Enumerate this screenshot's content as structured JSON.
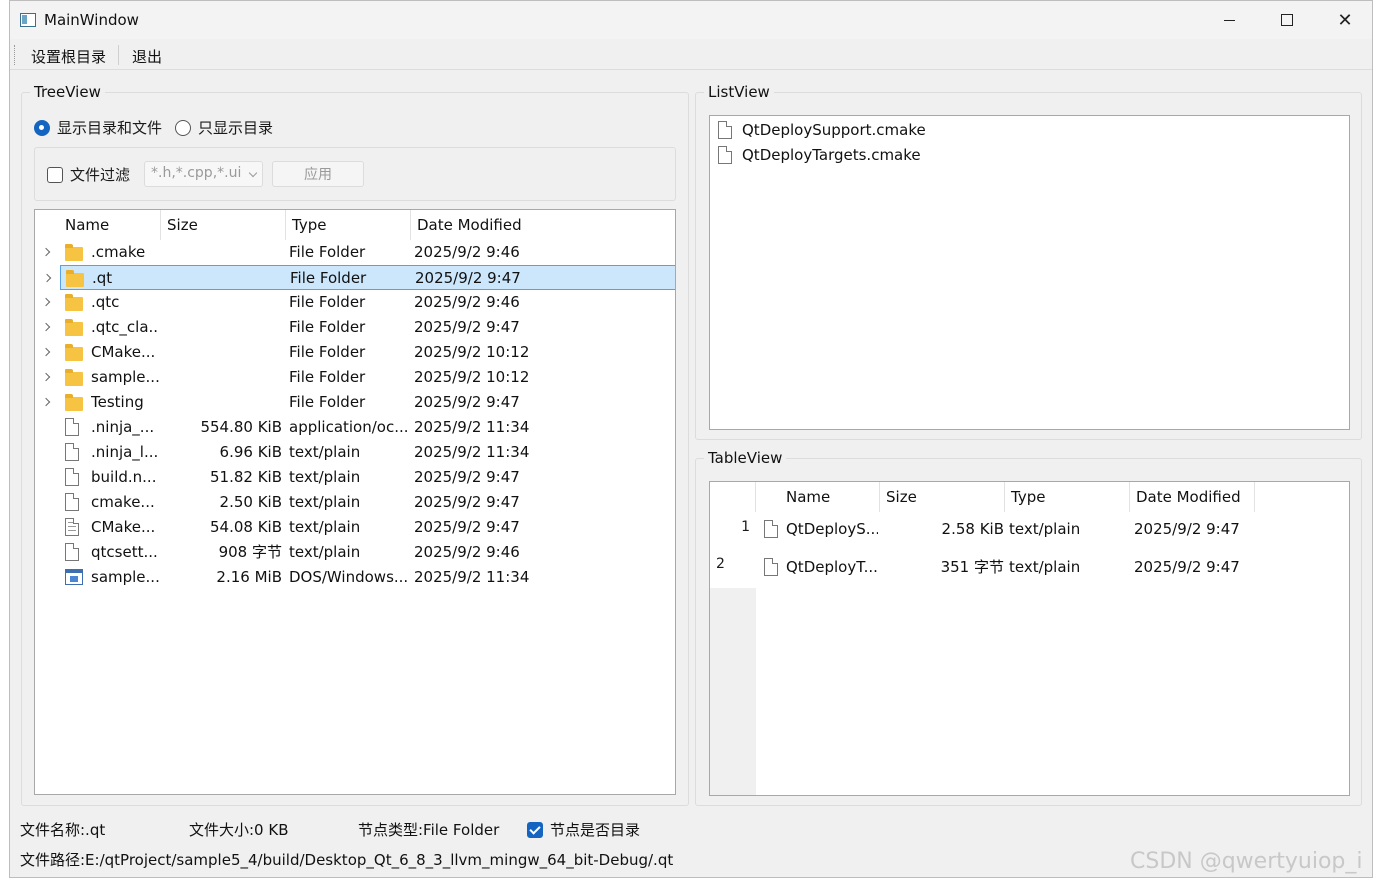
{
  "window": {
    "title": "MainWindow"
  },
  "menubar": {
    "items": [
      "设置根目录",
      "退出"
    ]
  },
  "treeview": {
    "group_title": "TreeView",
    "radio_all": "显示目录和文件",
    "radio_dirs": "只显示目录",
    "filter_label": "文件过滤",
    "filter_value": "*.h,*.cpp,*.ui",
    "apply_label": "应用",
    "headers": [
      "Name",
      "Size",
      "Type",
      "Date Modified"
    ],
    "rows": [
      {
        "name": ".cmake",
        "size": "",
        "type": "File Folder",
        "date": "2025/9/2 9:46",
        "icon": "folder-icon"
      },
      {
        "name": ".qt",
        "size": "",
        "type": "File Folder",
        "date": "2025/9/2 9:47",
        "icon": "folder-icon"
      },
      {
        "name": ".qtc",
        "size": "",
        "type": "File Folder",
        "date": "2025/9/2 9:46",
        "icon": "folder-icon"
      },
      {
        "name": ".qtc_cla...",
        "size": "",
        "type": "File Folder",
        "date": "2025/9/2 9:47",
        "icon": "folder-icon"
      },
      {
        "name": "CMake...",
        "size": "",
        "type": "File Folder",
        "date": "2025/9/2 10:12",
        "icon": "folder-icon"
      },
      {
        "name": "sample...",
        "size": "",
        "type": "File Folder",
        "date": "2025/9/2 10:12",
        "icon": "folder-icon"
      },
      {
        "name": "Testing",
        "size": "",
        "type": "File Folder",
        "date": "2025/9/2 9:47",
        "icon": "folder-icon"
      },
      {
        "name": ".ninja_...",
        "size": "554.80 KiB",
        "type": "application/oc...",
        "date": "2025/9/2 11:34",
        "icon": "file-icon"
      },
      {
        "name": ".ninja_l...",
        "size": "6.96 KiB",
        "type": "text/plain",
        "date": "2025/9/2 11:34",
        "icon": "file-icon"
      },
      {
        "name": "build.n...",
        "size": "51.82 KiB",
        "type": "text/plain",
        "date": "2025/9/2 9:47",
        "icon": "file-icon"
      },
      {
        "name": "cmake...",
        "size": "2.50 KiB",
        "type": "text/plain",
        "date": "2025/9/2 9:47",
        "icon": "file-icon"
      },
      {
        "name": "CMake...",
        "size": "54.08 KiB",
        "type": "text/plain",
        "date": "2025/9/2 9:47",
        "icon": "text-file-icon"
      },
      {
        "name": "qtcsett...",
        "size": "908 字节",
        "type": "text/plain",
        "date": "2025/9/2 9:46",
        "icon": "file-icon"
      },
      {
        "name": "sample...",
        "size": "2.16 MiB",
        "type": "DOS/Windows...",
        "date": "2025/9/2 11:34",
        "icon": "exe-icon"
      }
    ]
  },
  "listview": {
    "group_title": "ListView",
    "items": [
      "QtDeploySupport.cmake",
      "QtDeployTargets.cmake"
    ]
  },
  "tableview": {
    "group_title": "TableView",
    "headers": [
      "Name",
      "Size",
      "Type",
      "Date Modified"
    ],
    "rows": [
      {
        "num": "1",
        "name": "QtDeployS...",
        "size": "2.58 KiB",
        "type": "text/plain",
        "date": "2025/9/2 9:47"
      },
      {
        "num": "2",
        "name": "QtDeployT...",
        "size": "351 字节",
        "type": "text/plain",
        "date": "2025/9/2 9:47"
      }
    ]
  },
  "status": {
    "file_name": "文件名称:.qt",
    "file_size": "文件大小:0 KB",
    "node_type": "节点类型:File Folder",
    "is_dir_label": "节点是否目录",
    "path": "文件路径:E:/qtProject/sample5_4/build/Desktop_Qt_6_8_3_llvm_mingw_64_bit-Debug/.qt"
  },
  "watermark": "CSDN @qwertyuiop_i",
  "selected_row": 1
}
